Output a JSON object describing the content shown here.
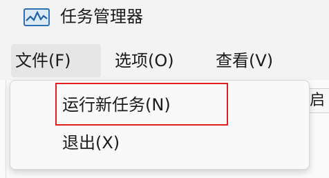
{
  "window": {
    "title": "任务管理器",
    "icon": "task-manager-icon"
  },
  "menubar": {
    "items": [
      {
        "label": "文件(F)",
        "state": "open"
      },
      {
        "label": "选项(O)"
      },
      {
        "label": "查看(V)"
      }
    ]
  },
  "file_menu": {
    "items": [
      {
        "label": "运行新任务(N)",
        "highlighted": true
      },
      {
        "label": "退出(X)"
      }
    ]
  },
  "background": {
    "partial_tab_text": "启"
  },
  "colors": {
    "highlight_border": "#e01e1e",
    "menu_bg": "#f9f9f9",
    "chrome_bg": "#f3f3f3"
  }
}
